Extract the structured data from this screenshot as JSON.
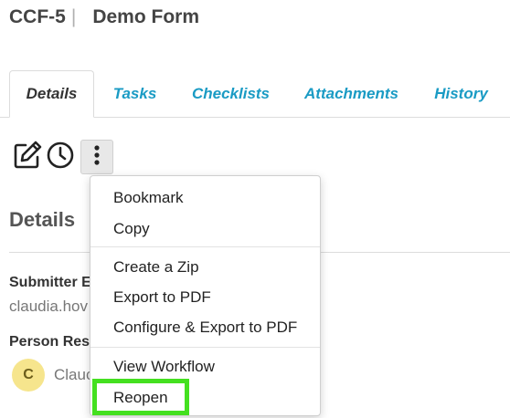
{
  "header": {
    "form_id": "CCF-5",
    "separator": "|",
    "form_name": "Demo Form"
  },
  "tabs": [
    {
      "label": "Details",
      "active": true
    },
    {
      "label": "Tasks",
      "active": false
    },
    {
      "label": "Checklists",
      "active": false
    },
    {
      "label": "Attachments",
      "active": false
    },
    {
      "label": "History",
      "active": false
    }
  ],
  "toolbar": {
    "icons": [
      "edit-icon",
      "clock-icon",
      "more-vertical-icon"
    ]
  },
  "details": {
    "title": "Details",
    "submitter_label": "Submitter E",
    "submitter_value": "claudia.hov",
    "person_label": "Person Res",
    "person_initial": "C",
    "person_name": "Clauc"
  },
  "menu": {
    "items": [
      "Bookmark",
      "Copy",
      "Create a Zip",
      "Export to PDF",
      "Configure & Export to PDF",
      "View Workflow",
      "Reopen"
    ],
    "highlighted": "Reopen"
  },
  "colors": {
    "tab_link": "#1a9bc4",
    "highlight": "#44e020",
    "avatar": "#f6e58d"
  }
}
